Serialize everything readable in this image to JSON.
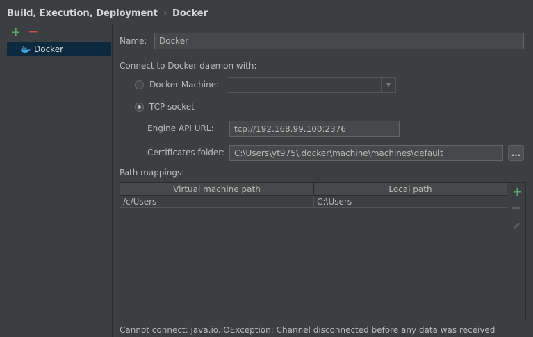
{
  "breadcrumb": {
    "parent": "Build, Execution, Deployment",
    "separator": "›",
    "current": "Docker"
  },
  "sidebar": {
    "items": [
      {
        "label": "Docker",
        "icon": "docker-icon"
      }
    ]
  },
  "form": {
    "name_label": "Name:",
    "name_value": "Docker",
    "connect_label": "Connect to Docker daemon with:",
    "docker_machine_label": "Docker Machine:",
    "docker_machine_value": "",
    "tcp_socket_label": "TCP socket",
    "selected": "tcp",
    "engine_api_label": "Engine API URL:",
    "engine_api_value": "tcp://192.168.99.100:2376",
    "certs_label": "Certificates folder:",
    "certs_value": "C:\\Users\\yt975\\.docker\\machine\\machines\\default",
    "browse_label": "..."
  },
  "path_mappings": {
    "label": "Path mappings:",
    "columns": [
      "Virtual machine path",
      "Local path"
    ],
    "rows": [
      {
        "vm": "/c/Users",
        "local": "C:\\Users"
      }
    ]
  },
  "status": {
    "message": "Cannot connect: java.io.IOException: Channel disconnected before any data was received"
  },
  "colors": {
    "background": "#3c3f41",
    "selection": "#0d293e",
    "add": "#59a869",
    "remove": "#c75450"
  }
}
